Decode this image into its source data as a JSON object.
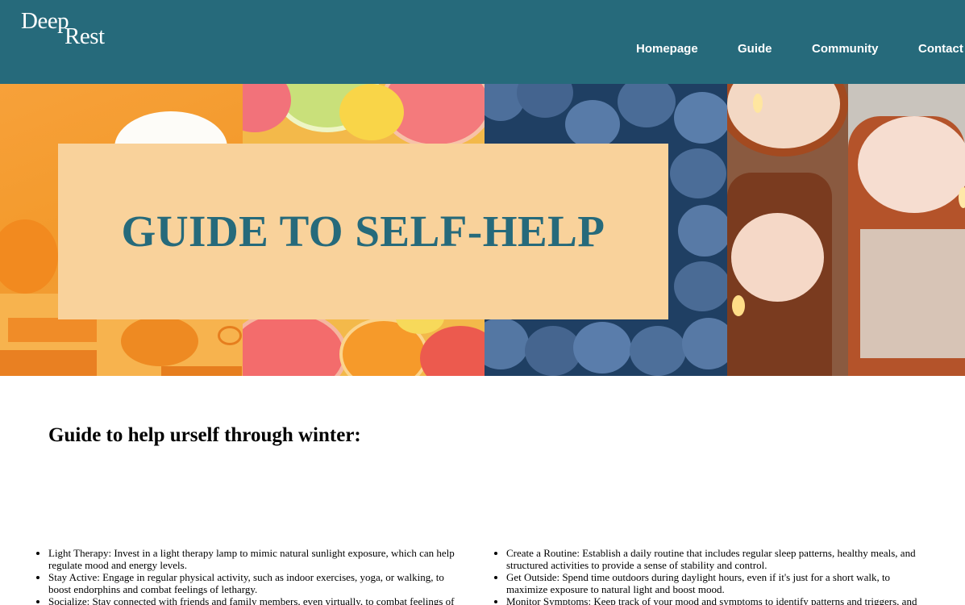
{
  "header": {
    "logo_line1": "Deep",
    "logo_line2": "Rest",
    "nav": [
      "Homepage",
      "Guide",
      "Community",
      "Contact"
    ]
  },
  "hero": {
    "title": "GUIDE TO SELF-HELP",
    "images": [
      "orange-still-life",
      "citrus-fruits",
      "blueberries",
      "candles"
    ]
  },
  "main": {
    "section_title": "Guide to help urself through winter:",
    "left_tips": [
      "Light Therapy: Invest in a light therapy lamp to mimic natural sunlight exposure, which can help regulate mood and energy levels.",
      "Stay Active: Engage in regular physical activity, such as indoor exercises, yoga, or walking, to boost endorphins and combat feelings of lethargy.",
      "Socialize: Stay connected with friends and family members, even virtually, to combat feelings of"
    ],
    "right_tips": [
      "Create a Routine: Establish a daily routine that includes regular sleep patterns, healthy meals, and structured activities to provide a sense of stability and control.",
      "Get Outside: Spend time outdoors during daylight hours, even if it's just for a short walk, to maximize exposure to natural light and boost mood.",
      "Monitor Symptoms: Keep track of your mood and symptoms to identify patterns and triggers, and"
    ]
  },
  "colors": {
    "header_bg": "#266a7b",
    "banner_bg": "#f9d29b",
    "title_color": "#266a7b"
  }
}
